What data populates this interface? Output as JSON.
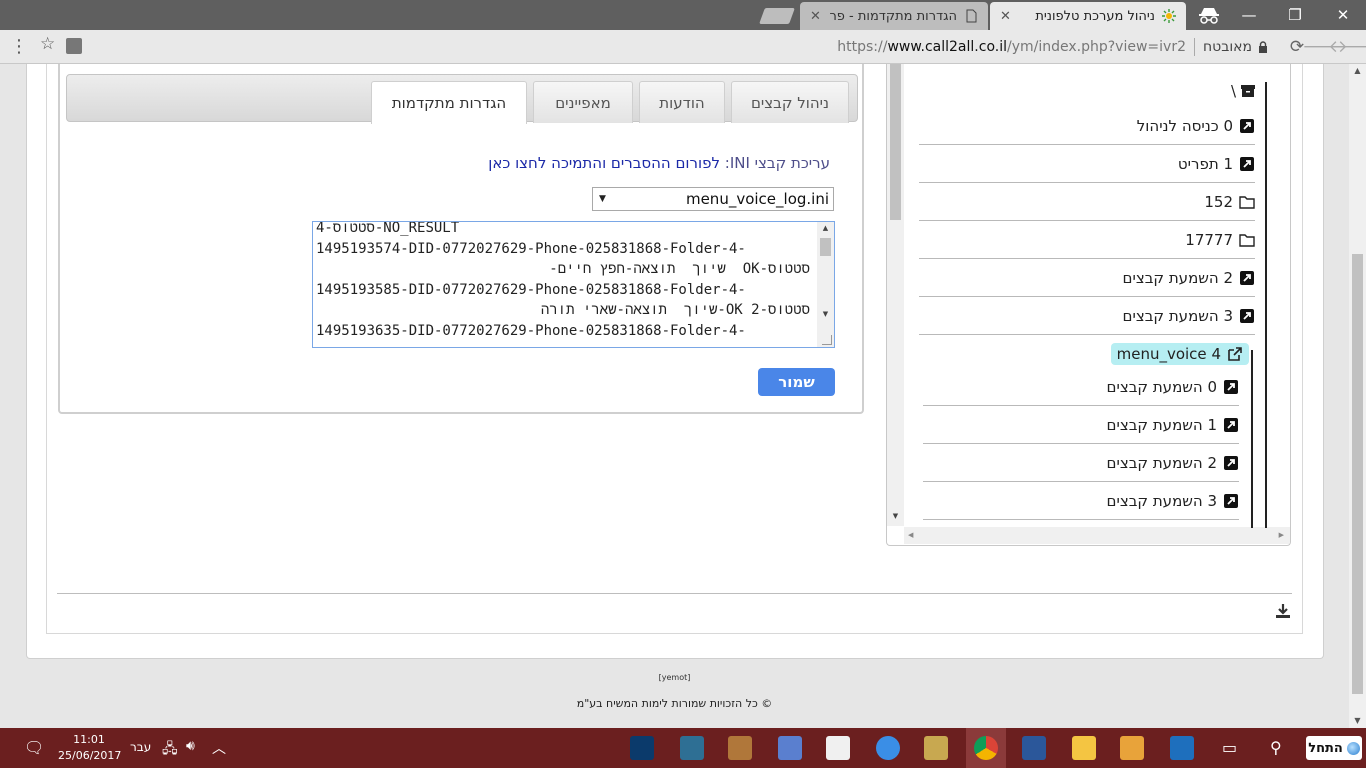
{
  "browser": {
    "tabs": [
      {
        "title": "ניהול מערכת טלפונית",
        "active": true
      },
      {
        "title": "הגדרות מתקדמות - פרסו",
        "active": false
      }
    ],
    "secure_label": "מאובטח",
    "url_prefix": "https://",
    "url_host": "www.call2all.co.il",
    "url_path": "/ym/index.php?view=ivr2"
  },
  "tabs": [
    {
      "label": "ניהול קבצים"
    },
    {
      "label": "הודעות"
    },
    {
      "label": "מאפיינים"
    },
    {
      "label": "הגדרות מתקדמות",
      "active": true
    }
  ],
  "editor": {
    "ini_label": "עריכת קבצי INI:",
    "ini_link": "לפורום ההסברים והתמיכה לחצו כאן",
    "selected_file": "menu_voice_log.ini",
    "lines": [
      {
        "text": "4-סטטוס-NO_RESULT",
        "rtl": false
      },
      {
        "text": "1495193574-DID-0772027629-Phone-025831868-Folder-4-",
        "rtl": false
      },
      {
        "text": "סטטוס-OK  שיוך  תוצאה-חפץ חיים-",
        "rtl": true
      },
      {
        "text": "1495193585-DID-0772027629-Phone-025831868-Folder-4-",
        "rtl": false
      },
      {
        "text": "סטטוס-OK 2-שיוך  תוצאה-שארי תורה",
        "rtl": true
      },
      {
        "text": "1495193635-DID-0772027629-Phone-025831868-Folder-4-",
        "rtl": false
      }
    ],
    "save_label": "שמור"
  },
  "tree": {
    "root_label": "\\",
    "items": [
      {
        "label": "0 כניסה לניהול",
        "icon": "external-link-square-icon"
      },
      {
        "label": "1 תפריט",
        "icon": "external-link-square-icon"
      },
      {
        "label": "152",
        "icon": "folder-icon"
      },
      {
        "label": "17777",
        "icon": "folder-icon"
      },
      {
        "label": "2 השמעת קבצים",
        "icon": "external-link-square-icon"
      },
      {
        "label": "3 השמעת קבצים",
        "icon": "external-link-square-icon"
      },
      {
        "label": "4 menu_voice",
        "icon": "external-link-icon",
        "highlight": true
      }
    ],
    "subitems": [
      {
        "label": "0 השמעת קבצים",
        "icon": "external-link-square-icon"
      },
      {
        "label": "1 השמעת קבצים",
        "icon": "external-link-square-icon"
      },
      {
        "label": "2 השמעת קבצים",
        "icon": "external-link-square-icon"
      },
      {
        "label": "3 השמעת קבצים",
        "icon": "external-link-square-icon"
      }
    ]
  },
  "footer": {
    "small_link": "[yemot]",
    "copyright": "© כל הזכויות שמורות לימות המשיח בע\"מ"
  },
  "taskbar": {
    "start_label": "התחל",
    "language": "עבר",
    "time": "11:01",
    "date": "25/06/2017"
  },
  "colors": {
    "accent": "#4a86e8",
    "link": "#1c2aa8",
    "highlight": "#b6eef2",
    "taskbar": "#6b1f1f"
  }
}
